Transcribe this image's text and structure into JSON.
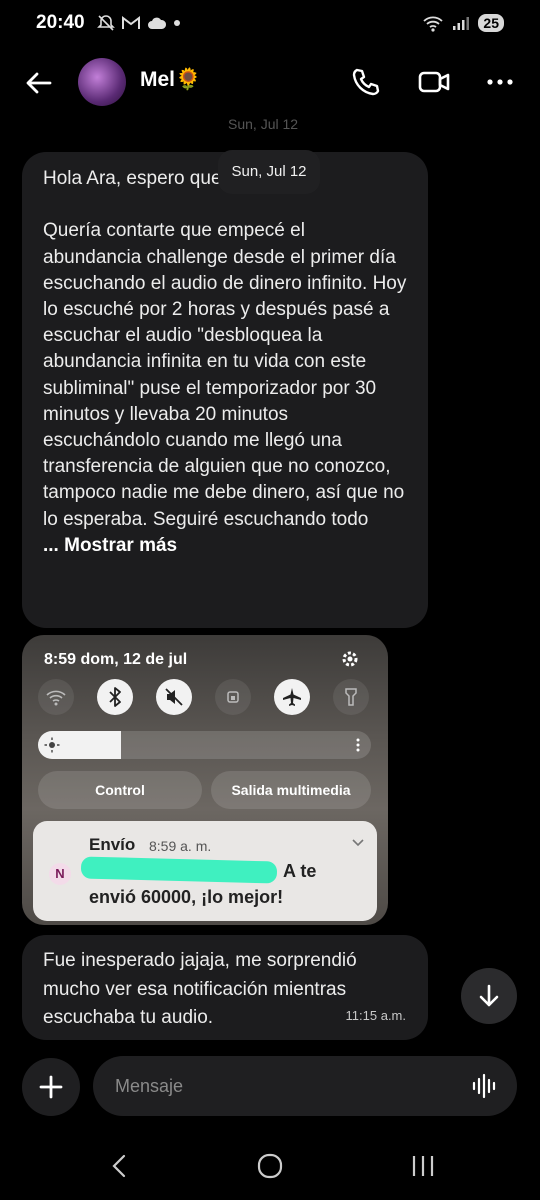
{
  "status_bar": {
    "time": "20:40",
    "battery": "25"
  },
  "header": {
    "contact_name": "Mel🌻"
  },
  "conversation": {
    "date_faded": "Sun, Jul 12",
    "date_pill": "Sun, Jul 12",
    "message1": {
      "text": "Hola Ara, espero que estés bien\n\nQuería contarte que empecé el abundancia challenge desde el primer día escuchando el audio de dinero infinito. Hoy lo escuché por 2 horas y después pasé a escuchar el audio \"desbloquea la abundancia infinita en tu vida con este subliminal\" puse el temporizador por 30 minutos y llevaba 20 minutos escuchándolo cuando me llegó una transferencia de alguien que no conozco, tampoco nadie me debe dinero, así que no lo esperaba. Seguiré escuchando todo",
      "more": "... Mostrar más"
    },
    "screenshot": {
      "time_date": "8:59  dom, 12 de jul",
      "control_label": "Control",
      "media_label": "Salida multimedia",
      "notification": {
        "app": "Envío",
        "time": "8:59 a. m.",
        "line1_start": "N",
        "line1_end": "A te",
        "line2": "envió 60000, ¡lo mejor!"
      },
      "brightness_level": 0.25
    },
    "message2": {
      "text": "Fue inesperado jajaja, me sorprendió mucho ver esa notificación mientras escuchaba tu audio.",
      "time": "11:15 a.m."
    }
  },
  "composer": {
    "placeholder": "Mensaje"
  },
  "colors": {
    "background": "#000000",
    "bubble": "#1c1c1e",
    "redaction": "#3ff0c0"
  }
}
